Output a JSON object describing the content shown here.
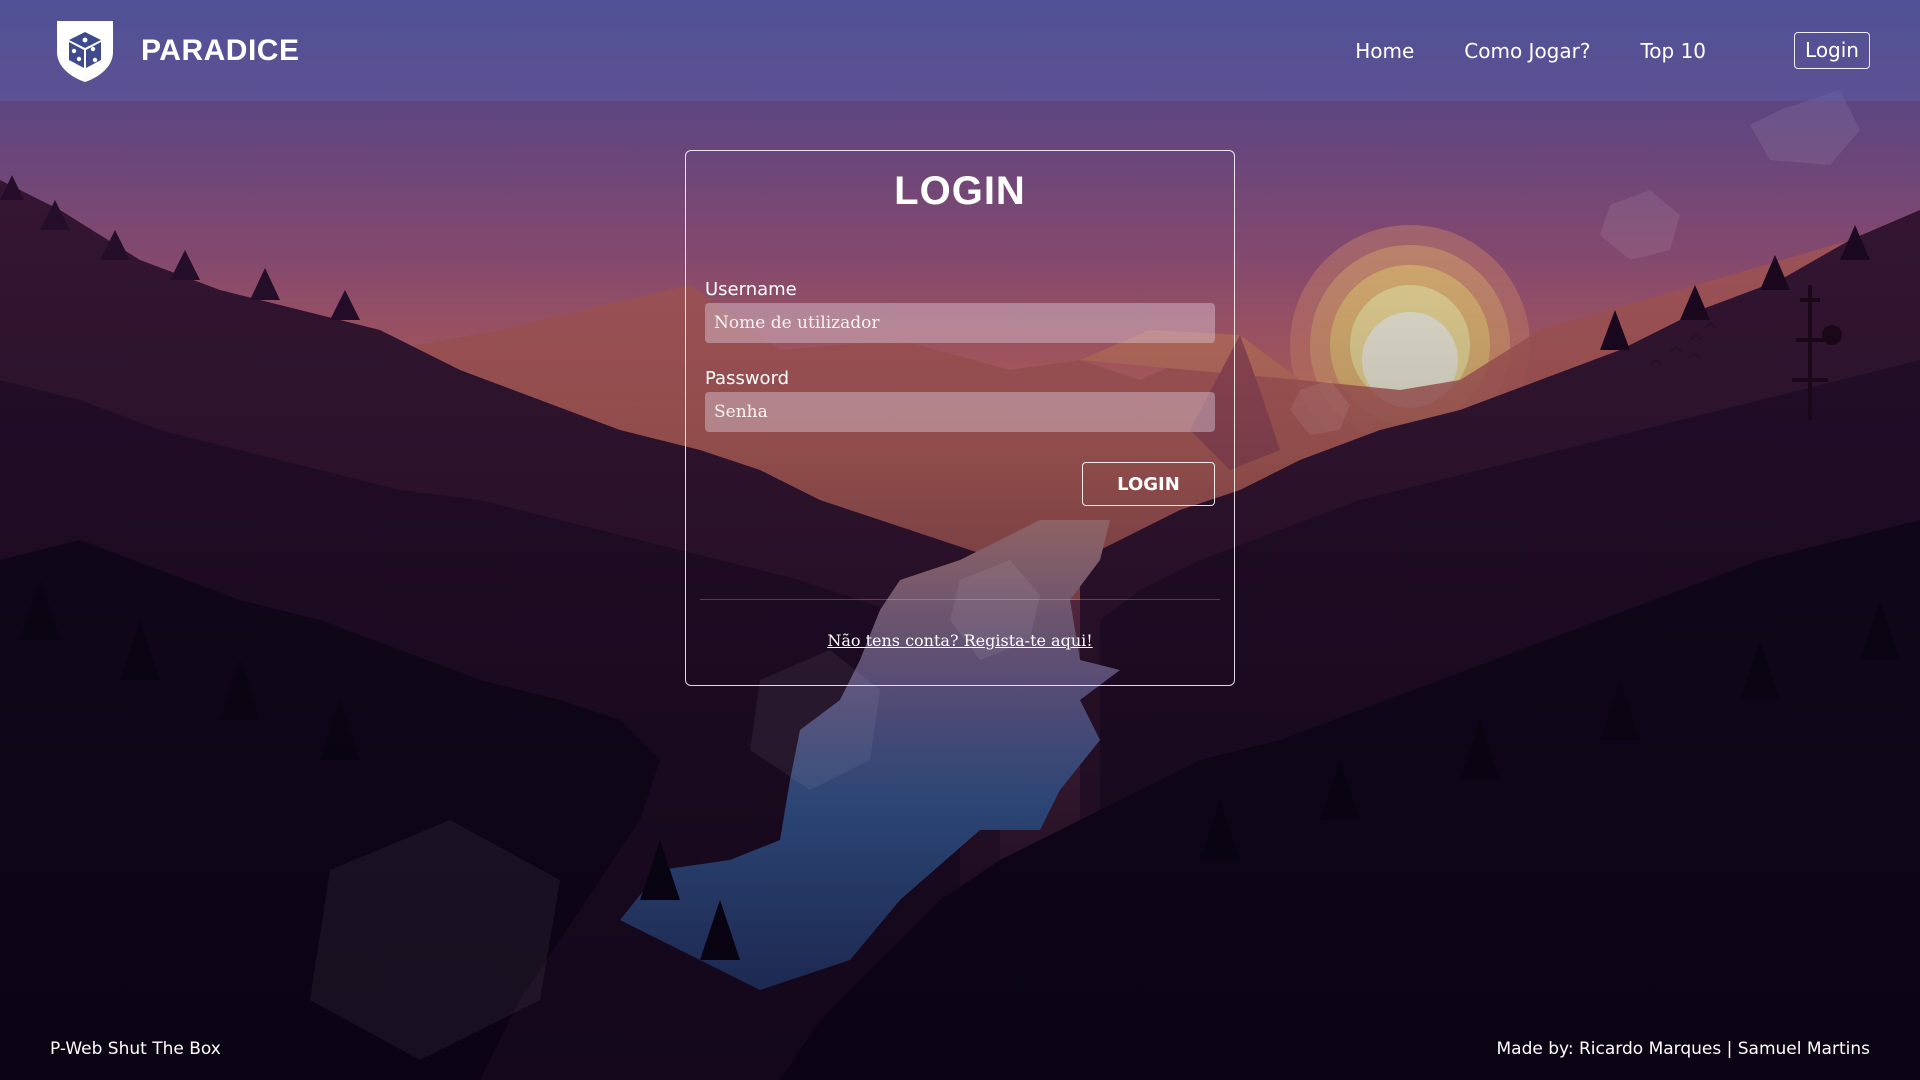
{
  "header": {
    "brand": "PARADICE",
    "logo_icon": "dice-shield-icon",
    "nav": [
      {
        "label": "Home"
      },
      {
        "label": "Como Jogar?"
      },
      {
        "label": "Top 10"
      }
    ],
    "login_label": "Login"
  },
  "login": {
    "title": "LOGIN",
    "username_label": "Username",
    "username_placeholder": "Nome de utilizador",
    "username_value": "",
    "password_label": "Password",
    "password_placeholder": "Senha",
    "password_value": "",
    "submit_label": "LOGIN",
    "register_link": "Não tens conta? Regista-te aqui!"
  },
  "footer": {
    "left": "P-Web Shut The Box",
    "right": "Made by: Ricardo Marques | Samuel Martins"
  },
  "colors": {
    "sky_top": "#4b4688",
    "sky_mid": "#b0607a",
    "sun": "#fff4d0",
    "river": "#5a8ad0",
    "forest_dark": "#10061e"
  }
}
